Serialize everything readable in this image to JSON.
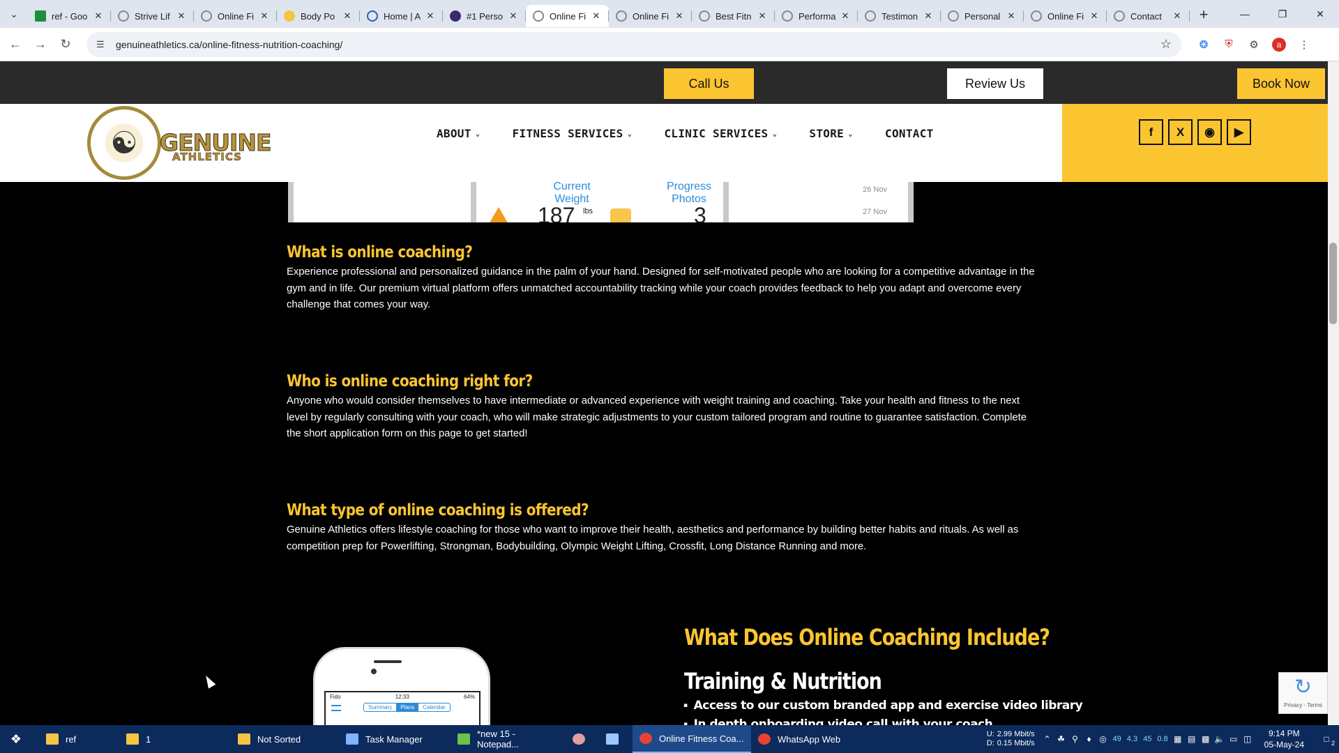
{
  "browser": {
    "tabs": [
      {
        "label": "ref - Goo",
        "icon": "sheets-icon"
      },
      {
        "label": "Strive Lif",
        "icon": "site-icon"
      },
      {
        "label": "Online Fi",
        "icon": "site-icon"
      },
      {
        "label": "Body Po",
        "icon": "site-icon"
      },
      {
        "label": "Home | A",
        "icon": "site-icon"
      },
      {
        "label": "#1 Perso",
        "icon": "site-icon"
      },
      {
        "label": "Online Fi",
        "icon": "site-icon",
        "active": true
      },
      {
        "label": "Online Fi",
        "icon": "site-icon"
      },
      {
        "label": "Best Fitn",
        "icon": "site-icon"
      },
      {
        "label": "Performa",
        "icon": "site-icon"
      },
      {
        "label": "Testimon",
        "icon": "site-icon"
      },
      {
        "label": "Personal",
        "icon": "site-icon"
      },
      {
        "label": "Online Fi",
        "icon": "site-icon"
      },
      {
        "label": "Contact",
        "icon": "site-icon"
      }
    ],
    "url": "genuineathletics.ca/online-fitness-nutrition-coaching/",
    "profile_initial": "a"
  },
  "site": {
    "topbar": {
      "call_us": "Call Us",
      "review_us": "Review Us",
      "book_now": "Book Now"
    },
    "logo": {
      "line1": "GENUINE",
      "line2": "ATHLETICS"
    },
    "nav": [
      {
        "label": "ABOUT",
        "has_dropdown": true
      },
      {
        "label": "FITNESS SERVICES",
        "has_dropdown": true
      },
      {
        "label": "CLINIC SERVICES",
        "has_dropdown": true
      },
      {
        "label": "STORE",
        "has_dropdown": true
      },
      {
        "label": "CONTACT",
        "has_dropdown": false
      }
    ],
    "social": [
      "facebook-icon",
      "x-icon",
      "instagram-icon",
      "youtube-icon"
    ],
    "accent_color": "#fbc531"
  },
  "hero": {
    "current_weight_label": "Current Weight",
    "current_weight_value": "187",
    "current_weight_unit": "lbs",
    "progress_photos_label": "Progress Photos",
    "progress_photos_value": "3",
    "dates": [
      "26 Nov",
      "27 Nov"
    ]
  },
  "sections": [
    {
      "heading": "What is online coaching?",
      "body": "Experience professional and personalized guidance in the palm of your hand. Designed for self-motivated people who are looking for a competitive advantage in the gym and in life. Our premium virtual platform offers unmatched accountability tracking while your coach provides feedback to help you adapt and overcome every challenge that comes your way."
    },
    {
      "heading": "Who is online coaching right for?",
      "body": "Anyone who would consider themselves to have intermediate or advanced experience with weight training and coaching. Take your health and fitness to the next level by regularly consulting with your coach, who will make strategic adjustments to your custom tailored program and routine to guarantee satisfaction. Complete the short application form on this page to get started!"
    },
    {
      "heading": "What type of online coaching is offered?",
      "body": "Genuine Athletics offers lifestyle coaching for those who want to improve their health, aesthetics and performance by building better habits and rituals. As well as competition prep for Powerlifting, Strongman, Bodybuilding, Olympic Weight Lifting, Crossfit, Long Distance Running and more."
    }
  ],
  "includes": {
    "heading": "What Does Online Coaching Include?",
    "subheading": "Training & Nutrition",
    "items": [
      "Access to our custom branded app and exercise video library",
      "In depth onboarding video call with your coach"
    ]
  },
  "app_preview": {
    "carrier": "Fido",
    "time": "12:33",
    "battery": "64%",
    "tabs": [
      "Summary",
      "Plans",
      "Calendar"
    ],
    "active_tab": "Plans"
  },
  "recaptcha": {
    "links": "Privacy - Terms"
  },
  "taskbar": {
    "items": [
      {
        "label": "ref",
        "color": "#f5c542"
      },
      {
        "label": "1",
        "color": "#f5c542"
      },
      {
        "label": "Not Sorted",
        "color": "#f5c542"
      },
      {
        "label": "Task Manager",
        "color": "#7fb3ff"
      },
      {
        "label": "*new 15 - Notepad...",
        "color": "#6cc24a"
      },
      {
        "label": "",
        "color": "#e0a0a0"
      },
      {
        "label": "",
        "color": "#9fc7ff"
      },
      {
        "label": "Online Fitness Coa...",
        "color": "#e94235",
        "active": true
      },
      {
        "label": "WhatsApp Web",
        "color": "#e94235"
      }
    ],
    "net_up": "2.99 Mbit/s",
    "net_down": "0.15 Mbit/s",
    "net_up_label": "U:",
    "net_down_label": "D:",
    "tray_numbers": [
      "49",
      "4.3",
      "45",
      "0.8"
    ],
    "time": "9:14 PM",
    "date": "05-May-24",
    "notifications": "2"
  }
}
